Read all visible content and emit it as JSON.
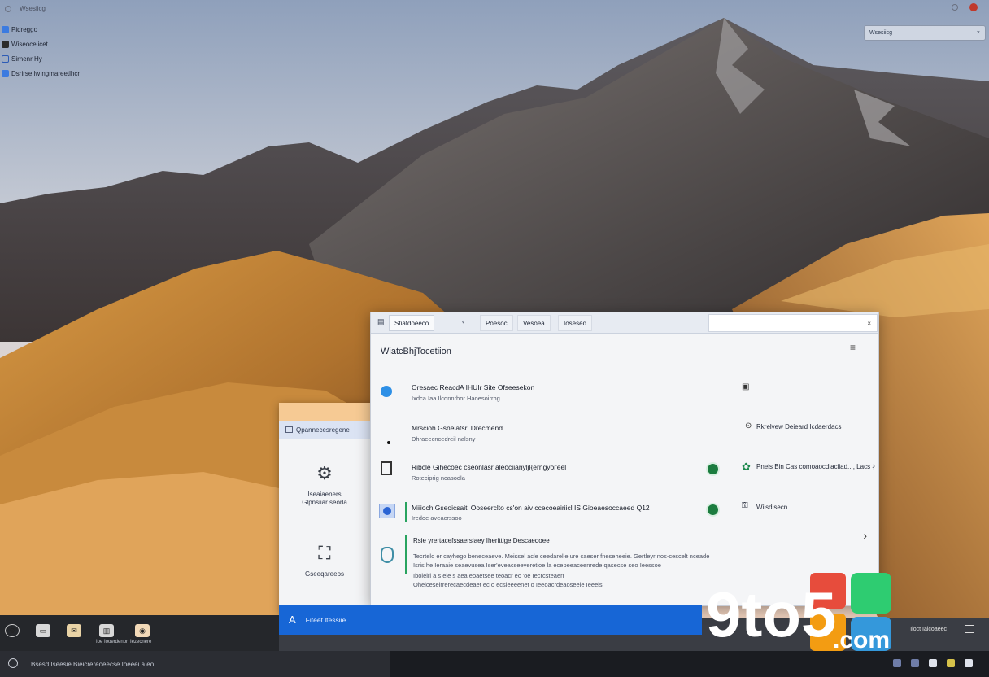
{
  "desktop": {
    "top_left_label": "Wsesiicg",
    "search_placeholder": "Wsesiicg",
    "search_clear": "×",
    "items": [
      {
        "label": "Pidreggo",
        "icon": "app-icon"
      },
      {
        "label": "Wiseoceiicet",
        "icon": "app-icon"
      },
      {
        "label": "Sirnenr Hy",
        "icon": "terminal-icon"
      },
      {
        "label": "Dsrirse lw ngmareetlhcr",
        "icon": "folder-icon"
      }
    ]
  },
  "back_window": {
    "selected_item": "Qpannecesregene",
    "tiles": [
      {
        "line1": "Iseaiaeners",
        "line2": "Glpnsiiar seorla",
        "icon": "puzzle-icon"
      },
      {
        "line1": "Gseeqareeos",
        "line2": "",
        "icon": "network-icon"
      }
    ]
  },
  "main_window": {
    "tabs": [
      "Stiafdoeeco",
      "Poesoc",
      "Vesoea",
      "Iosesed"
    ],
    "address_close": "×",
    "heading": "WiatcBhjTocetiion",
    "menu_icon": "≡",
    "rows": [
      {
        "title": "Oresaec ReacdA IHUIr Site Ofseesekon",
        "sub": "Ixdca Iaa Ilcdnnrhor Haoesoirrhg",
        "right_icon": "lock-icon",
        "right_text": ""
      },
      {
        "title": "Mrscioh Gsneiatsrl Drecmend",
        "sub": "Dhraeecncedreil nalsny",
        "right_icon": "shield-check-icon",
        "right_text": "Rkrelvew Deieard Icdaerdacs"
      },
      {
        "title": "Ribcle Gihecoec cseonlasr aleociianyljl{erngyoi'eel",
        "sub": "Roteciprig ncasodla",
        "right_icon": "gear-icon",
        "right_text": "Pneis Bin Cas comoaocdlaciiad..., Lacs ∤"
      },
      {
        "title": "Miiioch Gseoicsaiti Ooseerclto cs'on aiv ccecoeairiicl IS Gioeaesoccaeed Q12",
        "sub": "Iredoe aveacrssoo",
        "right_icon": "key-icon",
        "right_text": "Wiisdisecn"
      }
    ],
    "section_title": "Rsie yrertacefssaersiaey Iherittige Descaedoee",
    "paragraph": [
      "Tecrtelo er cayhego beneceaeve. Meissel acle ceedarelie ure caeser fneseheeie. Gertleyr nos-cescelt nceade",
      "Isris he Ieraaie seaevusea Iser'eveacseeveretioe la ecepeeaceenrede qasecse seo Ieessoe",
      "Iboieiri a s eie s aea eoaetsee teoacr ec 'oe Iecrcsteaerr",
      "Oheiceseirrerecaecdeaet ec o ecsieeeenet o Ieeoacrdeaoseele Ieeeis"
    ],
    "chevron": "›"
  },
  "status_bar": {
    "icon": "A",
    "label": "Fiteet ltessiie"
  },
  "dock": {
    "items": [
      {
        "label": "",
        "icon": "settings-icon"
      },
      {
        "label": "",
        "icon": "finder-icon"
      },
      {
        "label": "",
        "icon": "mail-icon"
      },
      {
        "label": "Ioe Iooerdenor",
        "icon": "calendar-icon"
      },
      {
        "label": "Iezecnere",
        "icon": "photos-icon"
      }
    ]
  },
  "taskbar": {
    "text": "Bsesd Iseesie Bieicrereoeecse    Ioeeei a eo",
    "tray_label": "Iioct Iaicoaeec"
  },
  "watermark": {
    "text": "9to5",
    "domain": ".com",
    "colors": [
      "#e74c3c",
      "#f39c12",
      "#2ecc71",
      "#3498db"
    ]
  },
  "colors": {
    "accent": "#1766d6",
    "toggle_on": "#1b7c3f",
    "titlebar": "#e7ebf2",
    "window_bg": "#f4f5f7"
  }
}
